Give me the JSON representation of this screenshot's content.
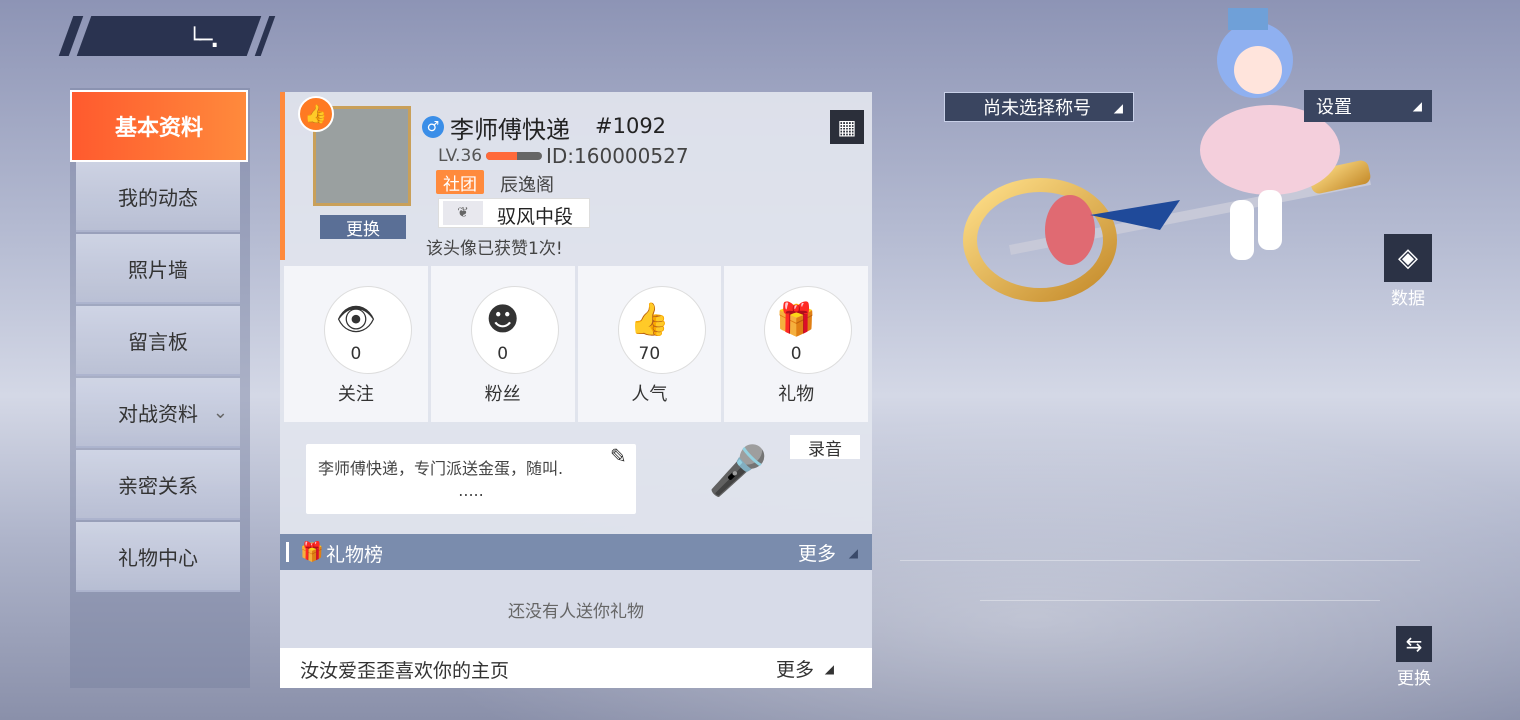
{
  "nav": {
    "back_icon": "back-arrow-icon",
    "menu": [
      {
        "label": "基本资料",
        "active": true
      },
      {
        "label": "我的动态"
      },
      {
        "label": "照片墙"
      },
      {
        "label": "留言板"
      },
      {
        "label": "对战资料"
      },
      {
        "label": "亲密关系"
      },
      {
        "label": "礼物中心"
      }
    ]
  },
  "profile": {
    "change_avatar": "更换",
    "name": "李师傅快递",
    "tag": "#1092",
    "level": "LV.36",
    "level_progress": 0.55,
    "id": "ID:160000527",
    "club_badge": "社团",
    "club_name": "辰逸阁",
    "rank": "驭风中段",
    "avatar_likes_text": "该头像已获赞1次!"
  },
  "stats": [
    {
      "icon": "eye-icon",
      "value": "0",
      "label": "关注"
    },
    {
      "icon": "fans-icon",
      "value": "0",
      "label": "粉丝"
    },
    {
      "icon": "thumbs-up-icon",
      "value": "70",
      "label": "人气"
    },
    {
      "icon": "gift-icon",
      "value": "0",
      "label": "礼物"
    }
  ],
  "signature": {
    "text": "李师傅快递，专门派送金蛋，随叫.",
    "ellipsis": ".....",
    "record_label": "录音"
  },
  "gift_board": {
    "title": "礼物榜",
    "more": "更多",
    "empty_text": "还没有人送你礼物"
  },
  "footer": {
    "text": "汝汝爱歪歪喜欢你的主页",
    "more": "更多"
  },
  "right": {
    "title_select": "尚未选择称号",
    "settings": "设置",
    "data_label": "数据",
    "swap_label": "更换"
  },
  "colors": {
    "accent": "#ff7a2e",
    "panel_header": "#7a8cad",
    "dark_button": "#2b3245"
  }
}
